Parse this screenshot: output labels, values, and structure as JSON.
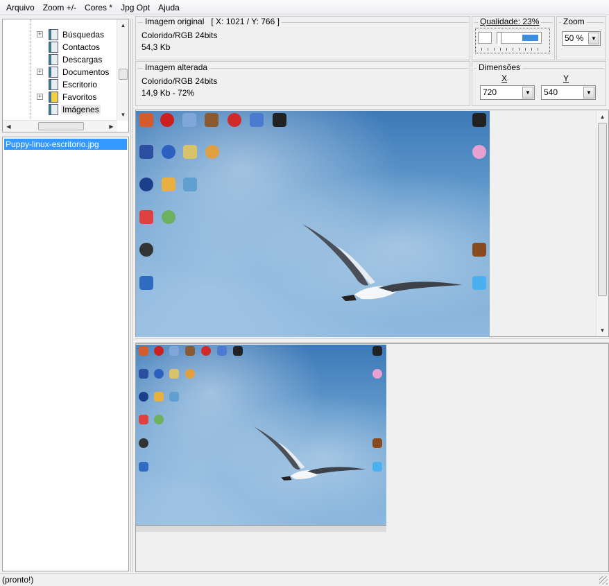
{
  "menu": [
    "Arquivo",
    "Zoom +/-",
    "Cores *",
    "Jpg Opt",
    "Ajuda"
  ],
  "tree": {
    "items": [
      {
        "label": "Búsquedas",
        "expandable": true
      },
      {
        "label": "Contactos",
        "expandable": false
      },
      {
        "label": "Descargas",
        "expandable": false
      },
      {
        "label": "Documentos",
        "expandable": true
      },
      {
        "label": "Escritorio",
        "expandable": false
      },
      {
        "label": "Favoritos",
        "expandable": true
      },
      {
        "label": "Imágenes",
        "expandable": false,
        "selected": true
      }
    ]
  },
  "files": [
    "Puppy-linux-escritorio.jpg"
  ],
  "original": {
    "legend": "Imagem original",
    "coords": "[ X: 1021 / Y: 766 ]",
    "color": "Colorido/RGB 24bits",
    "size": "54,3 Kb"
  },
  "altered": {
    "legend": "Imagem alterada",
    "color": "Colorido/RGB 24bits",
    "size": "14,9 Kb  - 72%"
  },
  "quality": {
    "legend": "Qualidade: 23%",
    "value_percent": 23
  },
  "zoom": {
    "legend": "Zoom",
    "value": "50 %"
  },
  "dimensions": {
    "legend": "Dimensões",
    "x_label": "X",
    "y_label": "Y",
    "x_value": "720",
    "y_value": "540"
  },
  "status": "(pronto!)",
  "colors": {
    "selection": "#3399ff",
    "slider": "#3b8ee6"
  }
}
